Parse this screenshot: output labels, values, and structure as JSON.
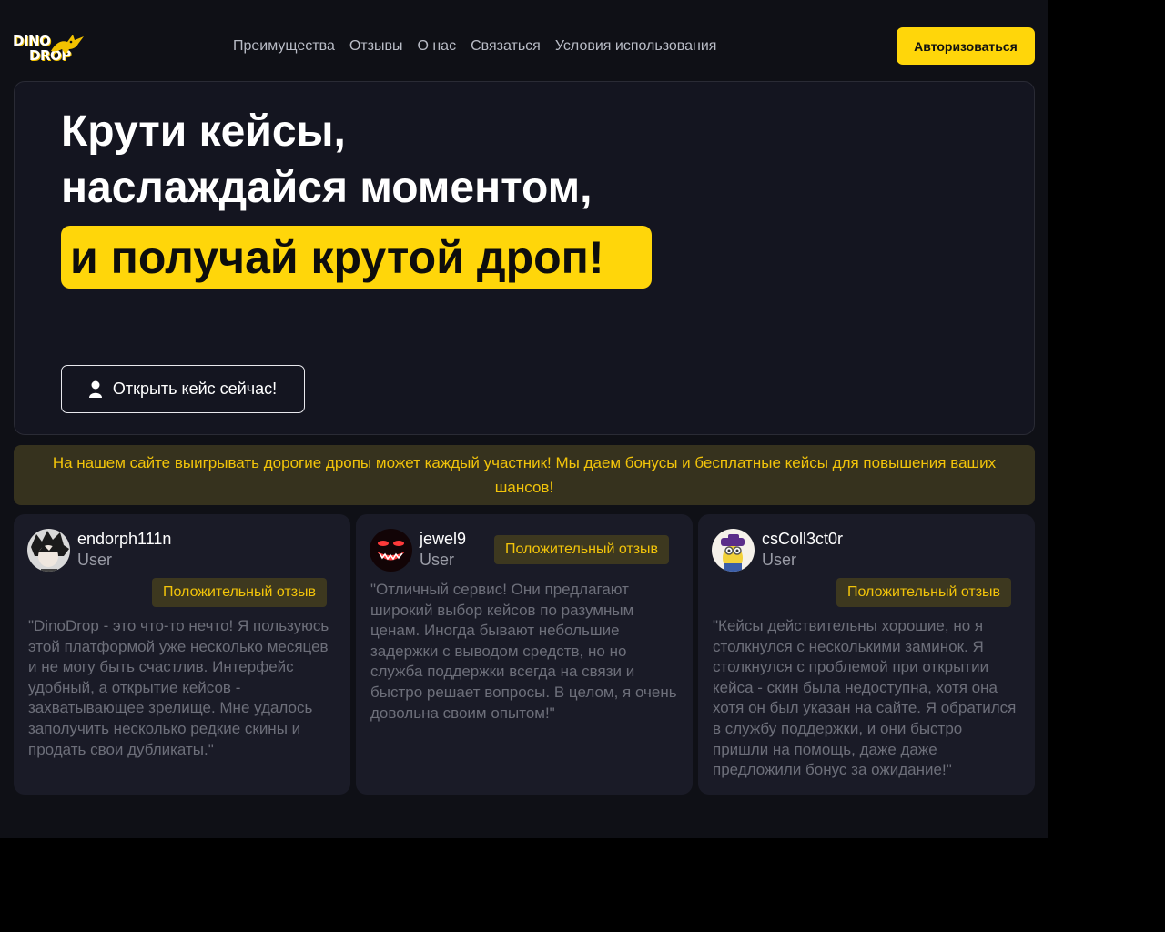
{
  "brand": {
    "logo_line1": "DINO",
    "logo_line2": "DROP"
  },
  "nav": {
    "items": [
      "Преимущества",
      "Отзывы",
      "О нас",
      "Связаться",
      "Условия использования"
    ]
  },
  "header": {
    "auth_label": "Авторизоваться"
  },
  "hero": {
    "line1": "Крути кейсы,",
    "line2": "наслаждайся моментом,",
    "line3": "и получай крутой дроп!",
    "cta_label": "Открыть кейс сейчас!"
  },
  "banner": {
    "text": "На нашем сайте выигрывать дорогие дропы может каждый участник! Мы даем бонусы и бесплатные кейсы для повышения ваших шансов!"
  },
  "reviews": [
    {
      "username": "endorph111n",
      "role": "User",
      "badge": "Положительный отзыв",
      "text": "\"DinoDrop - это что-то нечто! Я пользуюсь этой платформой уже несколько месяцев и не могу быть счастлив. Интерфейс удобный, а открытие кейсов - захватывающее зрелище. Мне удалось заполучить несколько редкие скины и продать свои дубликаты.\""
    },
    {
      "username": "jewel9",
      "role": "User",
      "badge": "Положительный отзыв",
      "text": "\"Отличный сервис! Они предлагают широкий выбор кейсов по разумным ценам. Иногда бывают небольшие задержки с выводом средств, но но служба поддержки всегда на связи и быстро решает вопросы. В целом, я очень довольна своим опытом!\""
    },
    {
      "username": "csColl3ct0r",
      "role": "User",
      "badge": "Положительный отзыв",
      "text": "\"Кейсы действительны хорошие, но я столкнулся с несколькими заминок. Я столкнулся с проблемой при открытии кейса - скин была недоступна, хотя она хотя он был указан на сайте. Я обратился в службу поддержки, и они быстро пришли на помощь, даже даже предложили бонус за ожидание!\""
    }
  ],
  "colors": {
    "accent": "#ffd60a",
    "page_bg": "#0f1016",
    "card_bg": "#1a1b27",
    "banner_bg": "#36321e",
    "badge_text": "#f2c40a"
  },
  "icons": [
    "logo-dragon-icon",
    "user-icon"
  ]
}
